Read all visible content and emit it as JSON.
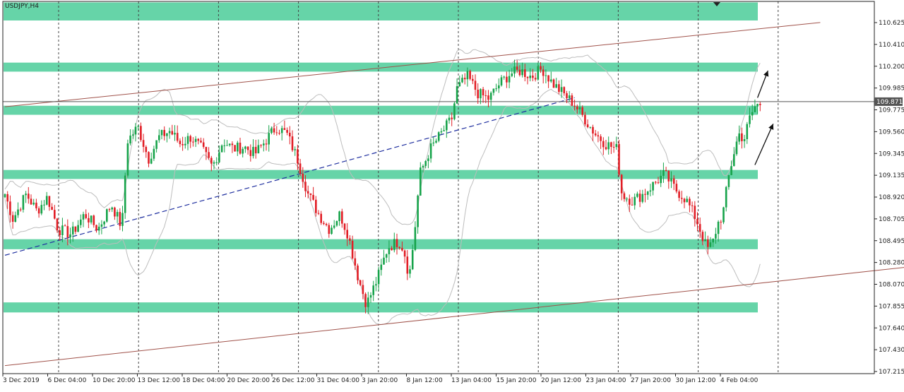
{
  "symbol_label": "USDJPY,H4",
  "colors": {
    "background": "#ffffff",
    "zone": "#66d4a8",
    "bull": "#16a34a",
    "bear": "#e11d25",
    "channel": "#a0524a",
    "trend": "#1f2f9f",
    "bands": "#bdbdbd",
    "grid": "#444444",
    "current_line": "#555555",
    "arrow": "#111111"
  },
  "chart_data": {
    "type": "candlestick",
    "symbol": "USDJPY",
    "timeframe": "H4",
    "current_price": "109.871",
    "y_ticks": [
      "110.625",
      "110.410",
      "110.200",
      "109.985",
      "109.775",
      "109.560",
      "109.345",
      "109.135",
      "108.920",
      "108.705",
      "108.495",
      "108.280",
      "108.070",
      "107.855",
      "107.640",
      "107.430",
      "107.215"
    ],
    "x_ticks": [
      "3 Dec 2019",
      "6 Dec 04:00",
      "10 Dec 20:00",
      "13 Dec 12:00",
      "18 Dec 04:00",
      "20 Dec 20:00",
      "26 Dec 12:00",
      "31 Dec 04:00",
      "3 Jan 20:00",
      "8 Jan 12:00",
      "13 Jan 04:00",
      "15 Jan 20:00",
      "20 Jan 12:00",
      "23 Jan 04:00",
      "27 Jan 20:00",
      "30 Jan 12:00",
      "4 Feb 04:00"
    ],
    "ylim": [
      107.16,
      110.87
    ],
    "zones": [
      {
        "from": 110.68,
        "to": 110.86
      },
      {
        "from": 110.17,
        "to": 110.26
      },
      {
        "from": 109.74,
        "to": 109.83
      },
      {
        "from": 109.1,
        "to": 109.19
      },
      {
        "from": 108.4,
        "to": 108.5
      },
      {
        "from": 107.77,
        "to": 107.87
      }
    ],
    "channel_upper": [
      [
        0,
        109.82
      ],
      [
        312,
        110.66
      ]
    ],
    "channel_lower": [
      [
        0,
        107.24
      ],
      [
        348,
        108.23
      ]
    ],
    "trendline": [
      [
        0,
        108.34
      ],
      [
        218,
        109.91
      ]
    ],
    "arrows": [
      {
        "from": [
          288,
          109.91
        ],
        "to": [
          292,
          110.18
        ]
      },
      {
        "from": [
          287,
          109.24
        ],
        "to": [
          294,
          109.65
        ]
      }
    ],
    "anchors": [
      [
        0,
        108.95
      ],
      [
        3,
        108.7
      ],
      [
        8,
        108.95
      ],
      [
        12,
        108.78
      ],
      [
        16,
        108.92
      ],
      [
        20,
        108.6
      ],
      [
        25,
        108.55
      ],
      [
        30,
        108.75
      ],
      [
        35,
        108.6
      ],
      [
        40,
        108.85
      ],
      [
        44,
        108.62
      ],
      [
        46,
        109.48
      ],
      [
        50,
        109.62
      ],
      [
        54,
        109.3
      ],
      [
        58,
        109.52
      ],
      [
        62,
        109.58
      ],
      [
        66,
        109.45
      ],
      [
        70,
        109.52
      ],
      [
        74,
        109.4
      ],
      [
        78,
        109.22
      ],
      [
        82,
        109.48
      ],
      [
        86,
        109.4
      ],
      [
        90,
        109.42
      ],
      [
        94,
        109.35
      ],
      [
        98,
        109.48
      ],
      [
        102,
        109.62
      ],
      [
        106,
        109.55
      ],
      [
        110,
        109.3
      ],
      [
        114,
        108.95
      ],
      [
        118,
        108.75
      ],
      [
        122,
        108.6
      ],
      [
        126,
        108.75
      ],
      [
        129,
        108.55
      ],
      [
        133,
        108.1
      ],
      [
        136,
        107.85
      ],
      [
        140,
        108.1
      ],
      [
        144,
        108.42
      ],
      [
        148,
        108.48
      ],
      [
        150,
        108.4
      ],
      [
        152,
        108.12
      ],
      [
        154,
        108.55
      ],
      [
        156,
        109.15
      ],
      [
        160,
        109.4
      ],
      [
        164,
        109.55
      ],
      [
        168,
        109.7
      ],
      [
        170,
        110.0
      ],
      [
        174,
        110.12
      ],
      [
        178,
        109.95
      ],
      [
        182,
        109.9
      ],
      [
        186,
        110.05
      ],
      [
        190,
        110.15
      ],
      [
        194,
        110.18
      ],
      [
        198,
        110.12
      ],
      [
        202,
        110.2
      ],
      [
        206,
        110.05
      ],
      [
        210,
        109.95
      ],
      [
        214,
        109.85
      ],
      [
        218,
        109.7
      ],
      [
        222,
        109.55
      ],
      [
        226,
        109.45
      ],
      [
        230,
        109.4
      ],
      [
        232,
        108.95
      ],
      [
        236,
        108.88
      ],
      [
        240,
        108.95
      ],
      [
        244,
        109.05
      ],
      [
        248,
        109.15
      ],
      [
        252,
        109.0
      ],
      [
        256,
        108.9
      ],
      [
        258,
        108.8
      ],
      [
        260,
        108.7
      ],
      [
        262,
        108.55
      ],
      [
        264,
        108.4
      ],
      [
        266,
        108.45
      ],
      [
        268,
        108.65
      ],
      [
        270,
        108.75
      ],
      [
        272,
        109.1
      ],
      [
        274,
        109.35
      ],
      [
        276,
        109.55
      ],
      [
        278,
        109.5
      ],
      [
        280,
        109.7
      ],
      [
        282,
        109.82
      ],
      [
        284,
        109.85
      ]
    ]
  }
}
